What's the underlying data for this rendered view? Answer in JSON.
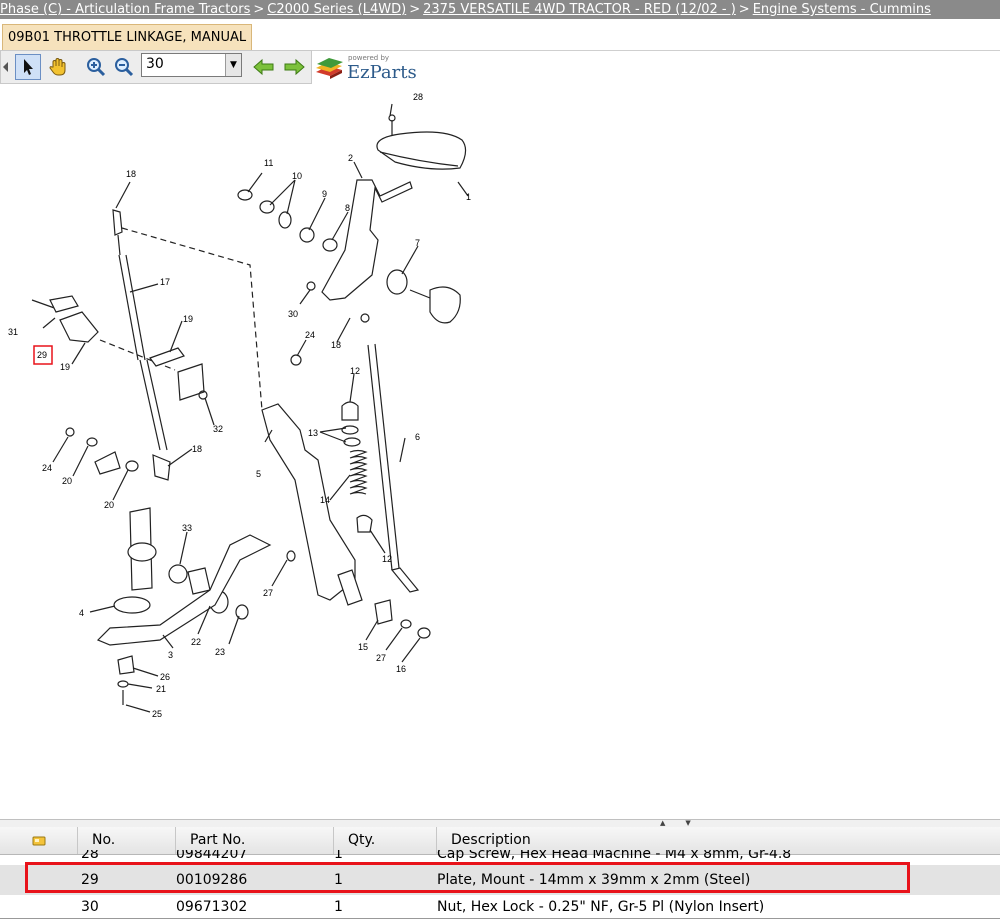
{
  "breadcrumb": {
    "items": [
      "Phase (C) - Articulation Frame Tractors",
      "C2000 Series (L4WD)",
      "2375 VERSATILE 4WD TRACTOR - RED (12/02 - )",
      "Engine Systems - Cummins"
    ],
    "separator": ">"
  },
  "tab": {
    "label": "09B01 THROTTLE LINKAGE, MANUAL"
  },
  "toolbar": {
    "zoom_value": "30",
    "icons": [
      "pointer-icon",
      "hand-pan-icon",
      "zoom-in-icon",
      "zoom-out-icon",
      "back-arrow-icon",
      "forward-arrow-icon"
    ]
  },
  "logo": {
    "powered_by": "powered by",
    "brand": "EzParts"
  },
  "diagram": {
    "callouts": [
      "28",
      "1",
      "2",
      "11",
      "10",
      "9",
      "18",
      "8",
      "7",
      "17",
      "30",
      "31",
      "29",
      "19",
      "19",
      "24",
      "18",
      "12",
      "32",
      "13",
      "24",
      "6",
      "18",
      "5",
      "20",
      "14",
      "20",
      "33",
      "12",
      "27",
      "4",
      "22",
      "3",
      "23",
      "15",
      "27",
      "16",
      "26",
      "21",
      "25"
    ],
    "highlighted_callout": "29"
  },
  "parts_table": {
    "columns": [
      "No.",
      "Part No.",
      "Qty.",
      "Description"
    ],
    "rows": [
      {
        "no": "28",
        "part": "09844207",
        "qty": "1",
        "desc": "Cap Screw, Hex Head Machine - M4 x 8mm, Gr-4.8"
      },
      {
        "no": "29",
        "part": "00109286",
        "qty": "1",
        "desc": "Plate, Mount - 14mm x 39mm x 2mm (Steel)"
      },
      {
        "no": "30",
        "part": "09671302",
        "qty": "1",
        "desc": "Nut, Hex Lock - 0.25\" NF, Gr-5 Pl (Nylon Insert)"
      }
    ],
    "selected_row": "29"
  },
  "colors": {
    "highlight": "#e8121a",
    "tab_bg": "#f6e2bc",
    "breadcrumb_bg": "#8a8a8a"
  }
}
